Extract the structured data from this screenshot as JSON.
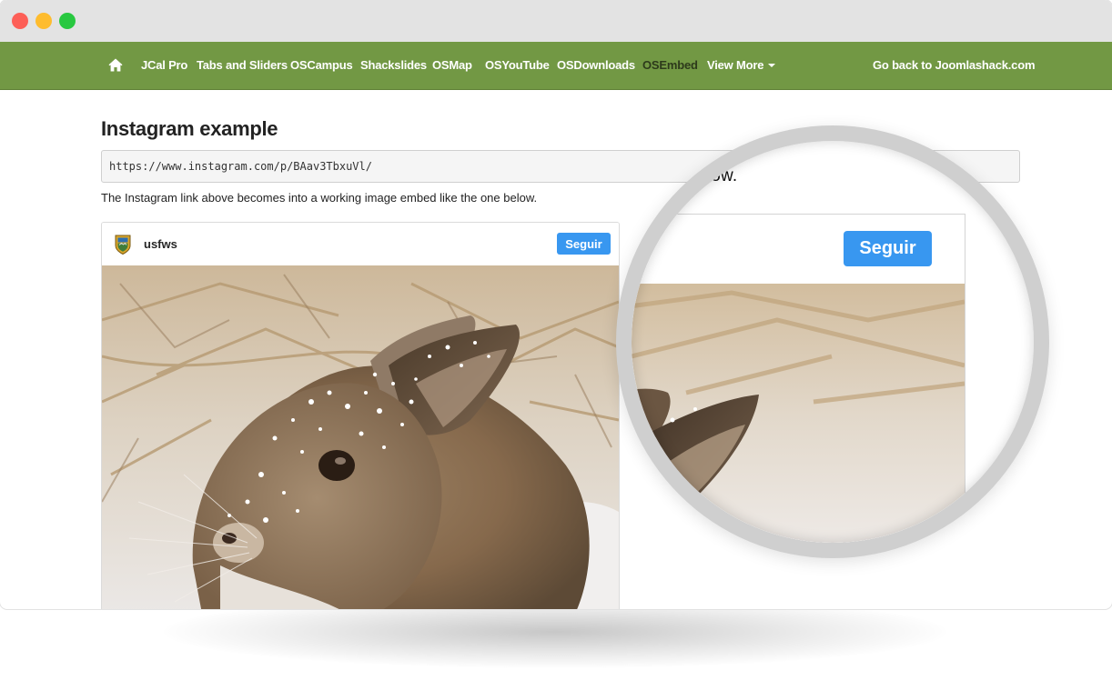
{
  "window": {
    "controls": [
      "close",
      "minimize",
      "maximize"
    ]
  },
  "nav": {
    "home_icon": "home-icon",
    "items": [
      {
        "label": "JCal Pro"
      },
      {
        "label": "Tabs and Sliders"
      },
      {
        "label": "OSCampus"
      },
      {
        "label": "Shackslides"
      },
      {
        "label": "OSMap"
      },
      {
        "label": "OSYouTube"
      },
      {
        "label": "OSDownloads"
      },
      {
        "label": "OSEmbed",
        "active": true
      },
      {
        "label": "View More",
        "dropdown": true
      }
    ],
    "right_link": "Go back to Joomlashack.com",
    "bar_color": "#729844"
  },
  "main": {
    "title": "Instagram example",
    "url": "https://www.instagram.com/p/BAav3TbxuVl/",
    "description": "The Instagram link above becomes into a working image embed like the one below."
  },
  "instagram": {
    "username": "usfws",
    "follow_label": "Seguir",
    "button_color": "#3897f0",
    "photo": "snowy-rabbit-photo"
  },
  "magnifier": {
    "visible_text": "elow.",
    "follow_label": "Seguir"
  }
}
